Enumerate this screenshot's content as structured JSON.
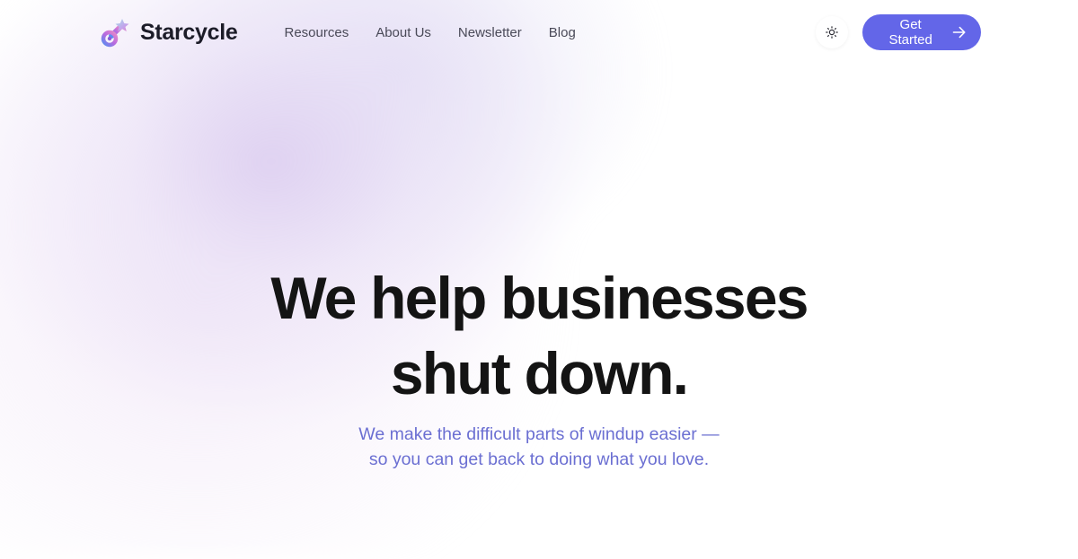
{
  "brand": {
    "name": "Starcycle",
    "logo_icon": "starcycle-logo-icon"
  },
  "nav": {
    "links": [
      {
        "label": "Resources"
      },
      {
        "label": "About Us"
      },
      {
        "label": "Newsletter"
      },
      {
        "label": "Blog"
      }
    ],
    "theme_toggle_icon": "sun-icon",
    "cta_label": "Get Started",
    "cta_icon": "arrow-right-icon"
  },
  "hero": {
    "headline_line1": "We help businesses",
    "headline_line2": "shut down.",
    "subtitle_line1": "We make the difficult parts of windup easier —",
    "subtitle_line2": "so you can get back to doing what you love."
  },
  "colors": {
    "accent": "#6366e8",
    "subtitle": "#6b6fd2",
    "headline": "#141414",
    "background_blob": "#e4d8f2"
  }
}
